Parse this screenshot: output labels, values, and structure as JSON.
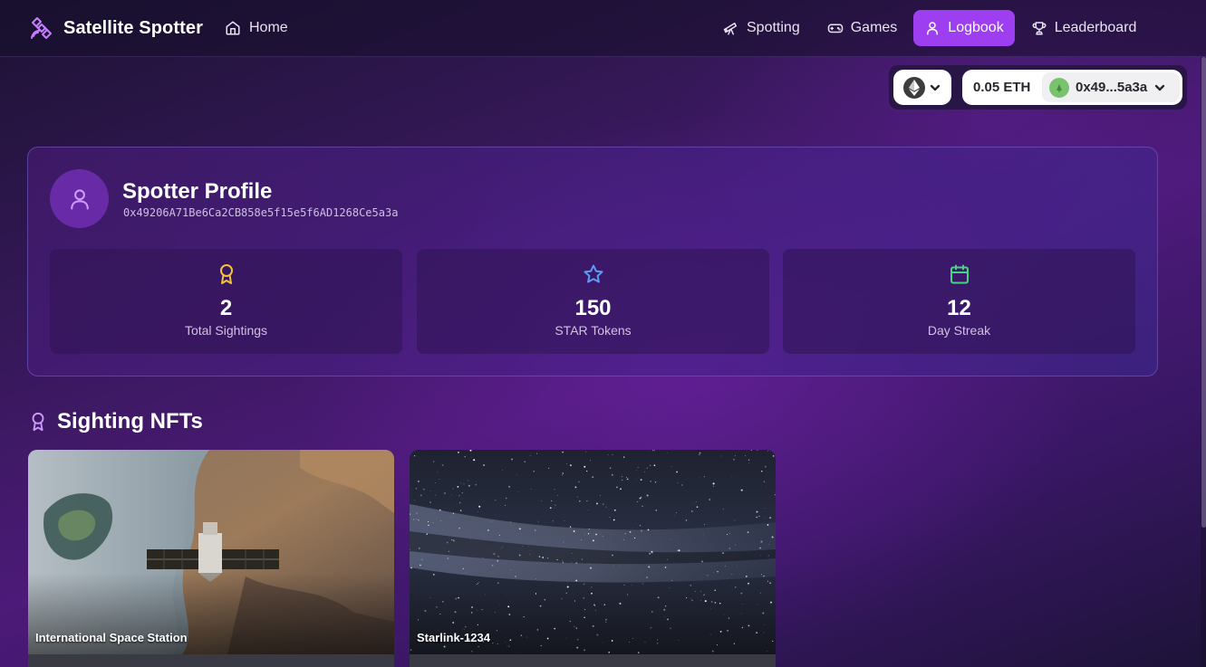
{
  "app": {
    "brand": "Satellite Spotter",
    "home_label": "Home"
  },
  "nav": {
    "items": [
      {
        "label": "Spotting",
        "icon": "telescope-icon",
        "active": false
      },
      {
        "label": "Games",
        "icon": "gamepad-icon",
        "active": false
      },
      {
        "label": "Logbook",
        "icon": "user-icon",
        "active": true
      },
      {
        "label": "Leaderboard",
        "icon": "trophy-icon",
        "active": false
      }
    ]
  },
  "wallet": {
    "chain_icon": "ethereum-icon",
    "balance": "0.05 ETH",
    "address_short": "0x49...5a3a"
  },
  "profile": {
    "title": "Spotter Profile",
    "address": "0x49206A71Be6Ca2CB858e5f15e5f6AD1268Ce5a3a",
    "stats": [
      {
        "value": "2",
        "label": "Total Sightings",
        "icon": "award-icon",
        "color": "#f5c23d"
      },
      {
        "value": "150",
        "label": "STAR Tokens",
        "icon": "star-icon",
        "color": "#5b9cf5"
      },
      {
        "value": "12",
        "label": "Day Streak",
        "icon": "calendar-icon",
        "color": "#45d483"
      }
    ]
  },
  "nfts": {
    "title": "Sighting NFTs",
    "items": [
      {
        "name": "International Space Station"
      },
      {
        "name": "Starlink-1234"
      }
    ]
  },
  "colors": {
    "accent": "#9d3ff0",
    "card_border": "#8c6edc"
  }
}
